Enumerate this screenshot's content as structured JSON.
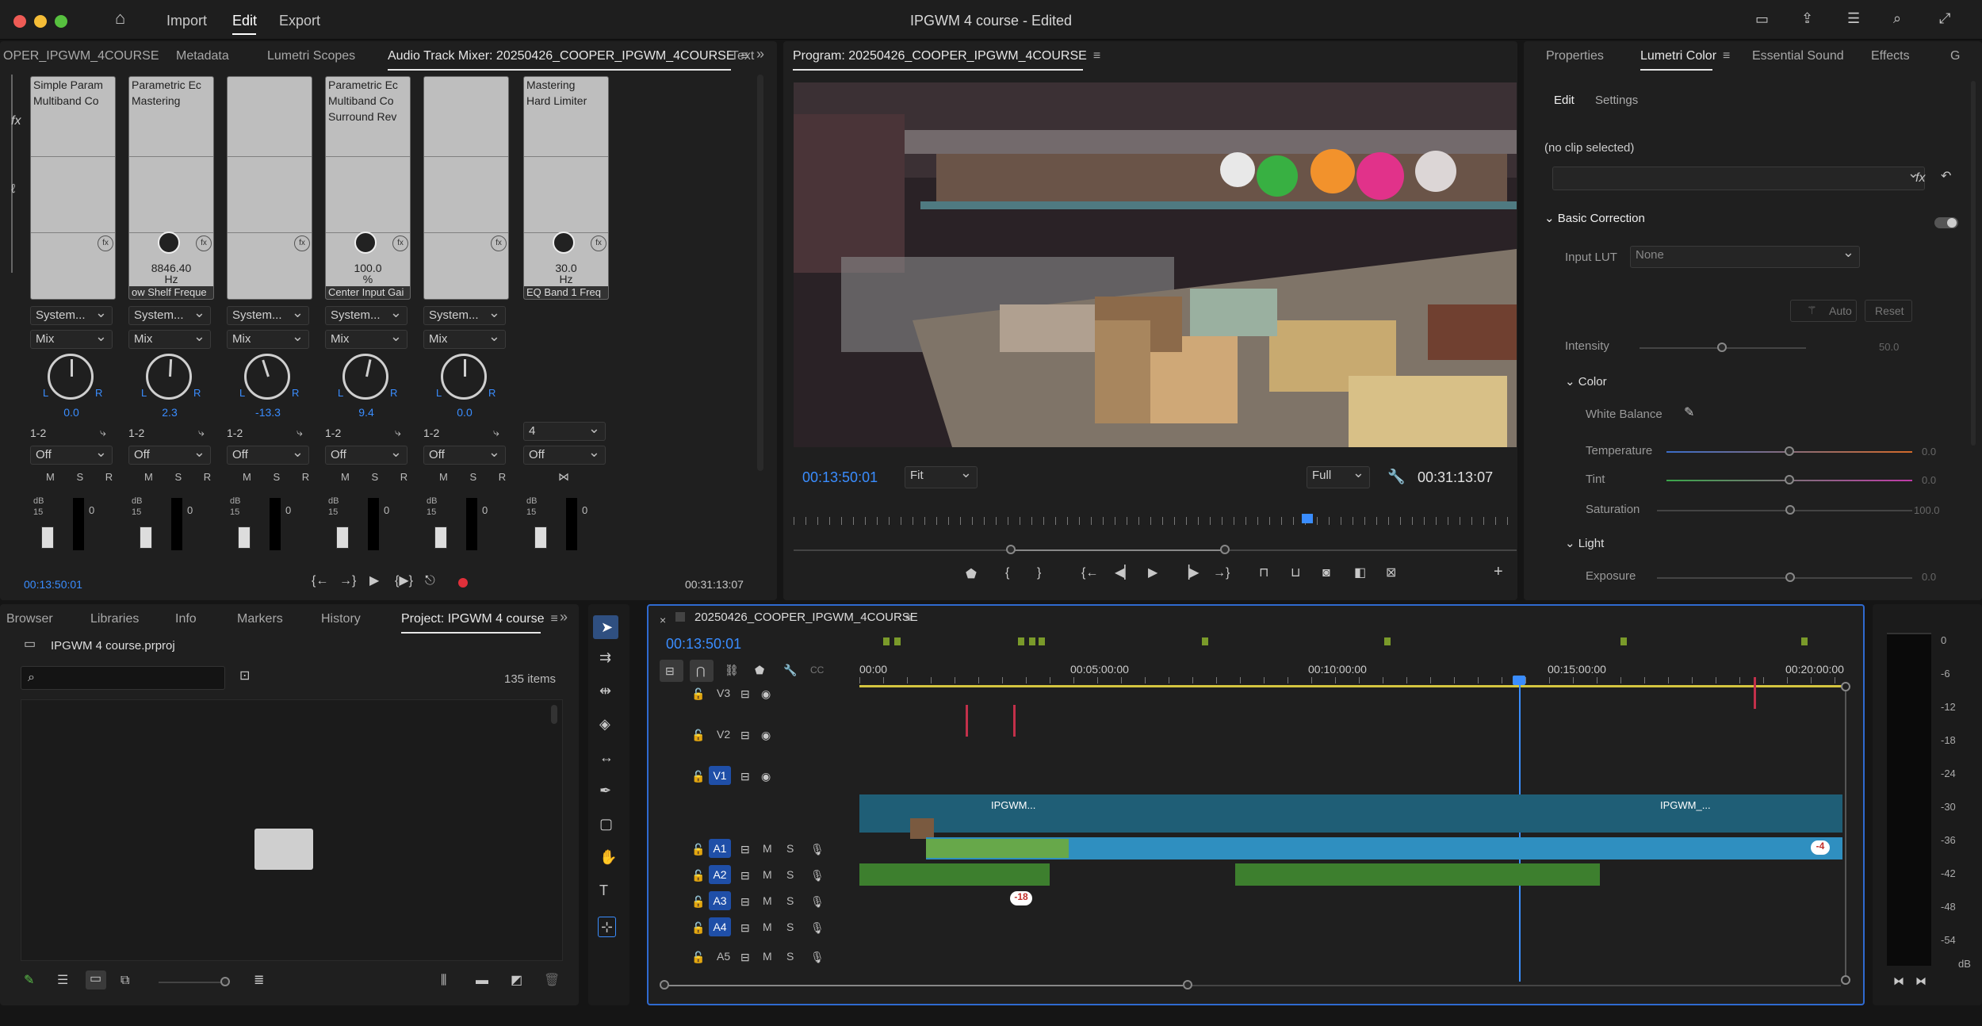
{
  "app": {
    "window_title": "IPGWM 4 course - Edited",
    "menu": [
      "Import",
      "Edit",
      "Export"
    ],
    "active_menu": "Edit"
  },
  "mixer": {
    "tabs": [
      "OPER_IPGWM_4COURSE",
      "Metadata",
      "Lumetri Scopes",
      "Audio Track Mixer: 20250426_COOPER_IPGWM_4COURSE",
      "Text"
    ],
    "active_tab": "Audio Track Mixer: 20250426_COOPER_IPGWM_4COURSE",
    "channels": [
      {
        "effects": [
          "Simple Param",
          "Multiband Co"
        ],
        "param_value": "",
        "param_unit": "",
        "param_name": "",
        "send": "System...",
        "mode": "Mix",
        "pan_value": "0.0",
        "pan_angle": 0,
        "route": "1-2",
        "auto": "Off"
      },
      {
        "effects": [
          "Parametric Ec",
          "Mastering"
        ],
        "param_value": "8846.40",
        "param_unit": "Hz",
        "param_name": "ow Shelf Freque",
        "send": "System...",
        "mode": "Mix",
        "pan_value": "2.3",
        "pan_angle": 3,
        "route": "1-2",
        "auto": "Off"
      },
      {
        "effects": [],
        "param_value": "",
        "param_unit": "",
        "param_name": "",
        "send": "System...",
        "mode": "Mix",
        "pan_value": "-13.3",
        "pan_angle": -18,
        "route": "1-2",
        "auto": "Off"
      },
      {
        "effects": [
          "Parametric Ec",
          "Multiband Co",
          "Surround Rev"
        ],
        "param_value": "100.0",
        "param_unit": "%",
        "param_name": "Center Input Gai",
        "send": "System...",
        "mode": "Mix",
        "pan_value": "9.4",
        "pan_angle": 12,
        "route": "1-2",
        "auto": "Off"
      },
      {
        "effects": [],
        "param_value": "",
        "param_unit": "",
        "param_name": "",
        "send": "System...",
        "mode": "Mix",
        "pan_value": "0.0",
        "pan_angle": 0,
        "route": "1-2",
        "auto": "Off"
      },
      {
        "effects": [
          "Mastering",
          "Hard Limiter"
        ],
        "param_value": "30.0",
        "param_unit": "Hz",
        "param_name": "EQ Band 1 Freq",
        "send": "",
        "mode": "",
        "pan_value": "",
        "pan_angle": 0,
        "route": "4",
        "auto": "Off"
      }
    ],
    "msr": "M S R",
    "db_label": "dB",
    "fader_15": "15",
    "fader_0": "0",
    "timecode_left": "00:13:50:01",
    "timecode_right": "00:31:13:07"
  },
  "program": {
    "title": "Program: 20250426_COOPER_IPGWM_4COURSE",
    "timecode": "00:13:50:01",
    "zoom": "Fit",
    "quality": "Full",
    "duration": "00:31:13:07"
  },
  "lumetri": {
    "tabs": [
      "Properties",
      "Lumetri Color",
      "Essential Sound",
      "Effects",
      "G"
    ],
    "active_tab": "Lumetri Color",
    "subtabs": [
      "Edit",
      "Settings"
    ],
    "no_clip": "(no clip selected)",
    "basic_correction": "Basic Correction",
    "input_lut_label": "Input LUT",
    "input_lut_value": "None",
    "auto": "Auto",
    "reset": "Reset",
    "intensity_label": "Intensity",
    "intensity_value": "50.0",
    "color_section": "Color",
    "white_balance": "White Balance",
    "temperature_label": "Temperature",
    "temperature_value": "0.0",
    "tint_label": "Tint",
    "tint_value": "0.0",
    "saturation_label": "Saturation",
    "saturation_value": "100.0",
    "light_section": "Light",
    "exposure_label": "Exposure",
    "exposure_value": "0.0"
  },
  "project": {
    "tabs": [
      "Browser",
      "Libraries",
      "Info",
      "Markers",
      "History",
      "Project: IPGWM 4 course"
    ],
    "active_tab": "Project: IPGWM 4 course",
    "file": "IPGWM 4 course.prproj",
    "search_placeholder": "",
    "count": "135 items"
  },
  "timeline": {
    "sequence": "20250426_COOPER_IPGWM_4COURSE",
    "timecode": "00:13:50:01",
    "ruler": [
      "00:00",
      "00:05:00:00",
      "00:10:00:00",
      "00:15:00:00",
      "00:20:00:00"
    ],
    "tracks": [
      "V3",
      "V2",
      "V1",
      "A1",
      "A2",
      "A3",
      "A4",
      "A5"
    ],
    "clip_labels": [
      "IPGWM...",
      "IPGWM_..."
    ],
    "msr": [
      "M",
      "S"
    ],
    "audio_badge_a": "-18",
    "audio_badge_b": "-4"
  },
  "meters": {
    "scale": [
      "0",
      "-6",
      "-12",
      "-18",
      "-24",
      "-30",
      "-36",
      "-42",
      "-48",
      "-54"
    ],
    "unit": "dB"
  }
}
